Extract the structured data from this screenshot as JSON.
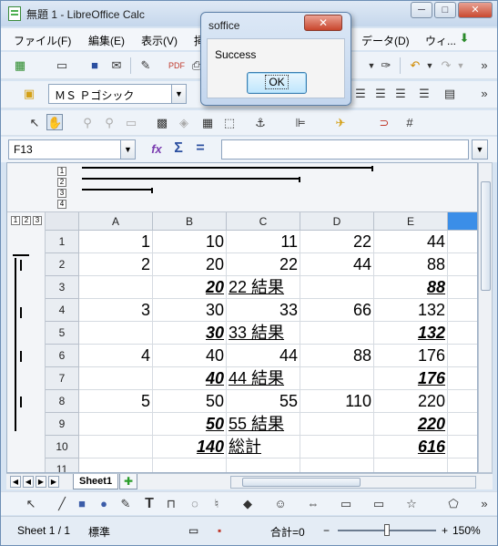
{
  "window": {
    "title": "無題 1 - LibreOffice Calc",
    "minimize": "─",
    "maximize": "□",
    "close": "✕"
  },
  "menu": [
    "ファイル(F)",
    "編集(E)",
    "表示(V)",
    "挿",
    "データ(D)",
    "ウィ..."
  ],
  "font": {
    "name": "ＭＳ Ｐゴシック"
  },
  "formula_bar": {
    "cell_ref": "F13",
    "function_wizard": "fx",
    "sum": "Σ",
    "equals": "=",
    "content": ""
  },
  "outline": {
    "row_levels": [
      "1",
      "2",
      "3",
      "4"
    ],
    "col_levels": [
      "1",
      "2",
      "3"
    ]
  },
  "columns": [
    "A",
    "B",
    "C",
    "D",
    "E"
  ],
  "rows": [
    {
      "num": "1",
      "A": "1",
      "B": "10",
      "C": "11",
      "D": "22",
      "E": "44"
    },
    {
      "num": "2",
      "A": "2",
      "B": "20",
      "C": "22",
      "D": "44",
      "E": "88"
    },
    {
      "num": "3",
      "A": "",
      "B": "20",
      "C": "22 結果",
      "D": "",
      "E": "88"
    },
    {
      "num": "4",
      "A": "3",
      "B": "30",
      "C": "33",
      "D": "66",
      "E": "132"
    },
    {
      "num": "5",
      "A": "",
      "B": "30",
      "C": "33 結果",
      "D": "",
      "E": "132"
    },
    {
      "num": "6",
      "A": "4",
      "B": "40",
      "C": "44",
      "D": "88",
      "E": "176"
    },
    {
      "num": "7",
      "A": "",
      "B": "40",
      "C": "44 結果",
      "D": "",
      "E": "176"
    },
    {
      "num": "8",
      "A": "5",
      "B": "50",
      "C": "55",
      "D": "110",
      "E": "220"
    },
    {
      "num": "9",
      "A": "",
      "B": "50",
      "C": "55 結果",
      "D": "",
      "E": "220"
    },
    {
      "num": "10",
      "A": "",
      "B": "140",
      "C": "総計",
      "D": "",
      "E": "616"
    },
    {
      "num": "11",
      "A": "",
      "B": "",
      "C": "",
      "D": "",
      "E": ""
    }
  ],
  "sheet_tab": "Sheet1",
  "statusbar": {
    "sheet": "Sheet 1 / 1",
    "style": "標準",
    "sum": "合計=0",
    "zoom_minus": "−",
    "zoom_plus": "+",
    "zoom": "150%"
  },
  "dialog": {
    "title": "soffice",
    "close": "✕",
    "message": "Success",
    "ok": "OK"
  }
}
